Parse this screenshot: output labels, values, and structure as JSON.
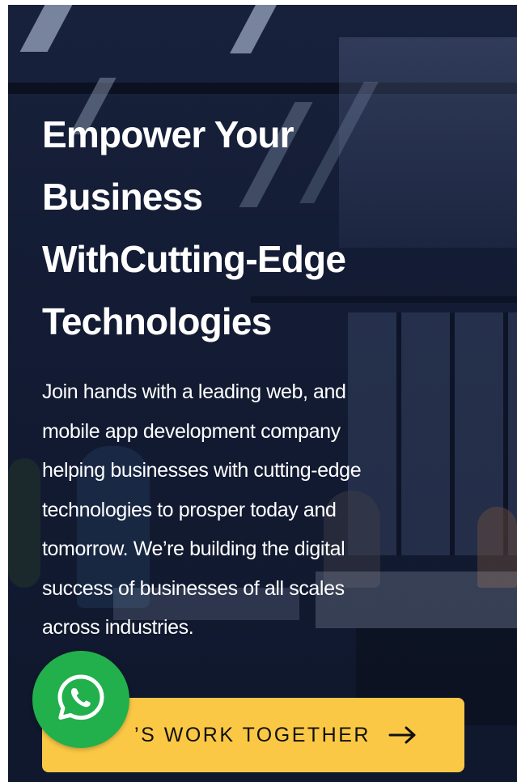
{
  "hero": {
    "headline": [
      "Empower Your",
      "Business",
      "WithCutting-Edge",
      "Technologies"
    ],
    "description": [
      "Join hands with a leading web, and",
      "mobile app development company",
      "helping businesses with cutting-edge",
      "technologies to prosper today and",
      "tomorrow. We’re building the digital",
      "success of businesses of all scales",
      "across industries."
    ],
    "cta": {
      "label_visible": "’S WORK TOGETHER",
      "label_full": "LET’S WORK TOGETHER",
      "icon": "arrow-right-icon"
    }
  },
  "floating": {
    "whatsapp_icon": "whatsapp-icon"
  },
  "colors": {
    "overlay": "#172038",
    "cta_background": "#fbc845",
    "whatsapp_green": "#22b04c",
    "text": "#ffffff"
  }
}
